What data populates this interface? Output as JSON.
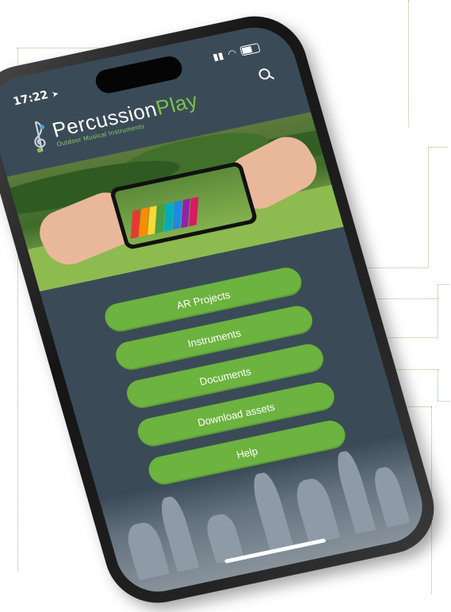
{
  "status_bar": {
    "time": "17:22"
  },
  "brand": {
    "name_part1": "Percussion",
    "name_part2": "Play",
    "tagline": "Outdoor Musical Instruments"
  },
  "menu": {
    "items": [
      {
        "label": "AR Projects"
      },
      {
        "label": "Instruments"
      },
      {
        "label": "Documents"
      },
      {
        "label": "Download assets"
      },
      {
        "label": "Help"
      }
    ]
  },
  "colors": {
    "screen_bg": "#3a4b57",
    "button_green": "#6cb33f",
    "guide_green": "#9cc27a"
  },
  "icons": [
    "search-icon",
    "location-arrow-icon",
    "signal-icon",
    "wifi-icon",
    "battery-icon",
    "treble-clef-logo-icon"
  ]
}
